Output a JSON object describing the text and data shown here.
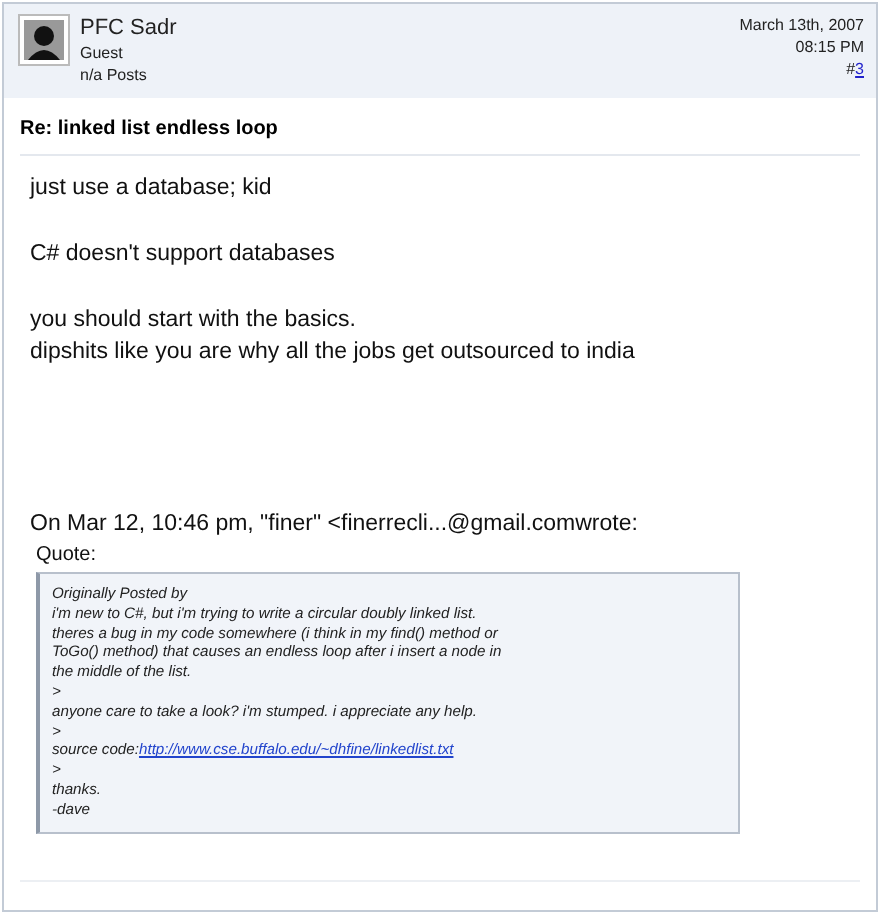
{
  "post": {
    "author": "PFC Sadr",
    "role": "Guest",
    "posts": "n/a Posts",
    "date": "March 13th, 2007",
    "time": "08:15 PM",
    "number_prefix": "#",
    "number": "3"
  },
  "title": "Re: linked list endless loop",
  "body": [
    [
      "just use a database; kid"
    ],
    [
      "C# doesn't support databases"
    ],
    [
      "you should start with the basics.",
      "dipshits like you are why all the jobs get outsourced to india"
    ],
    [
      "On Mar 12, 10:46 pm, \"finer\" <finerrecli...@gmail.comwrote:"
    ]
  ],
  "quote": {
    "label": "Quote:",
    "lines": [
      {
        "kind": "text",
        "text": "Originally Posted by"
      },
      {
        "kind": "text",
        "text": "i'm new to C#, but i'm trying to write a circular doubly linked list."
      },
      {
        "kind": "text",
        "text": "theres a bug in my code somewhere (i think in my find() method or"
      },
      {
        "kind": "text",
        "text": "ToGo() method) that causes an endless loop after i insert a node in"
      },
      {
        "kind": "text",
        "text": "the middle of the list."
      },
      {
        "kind": "text",
        "text": ">"
      },
      {
        "kind": "text",
        "text": "anyone care to take a look? i'm stumped. i appreciate any help."
      },
      {
        "kind": "text",
        "text": ">"
      },
      {
        "kind": "link",
        "text": "source code:",
        "link": "http://www.cse.buffalo.edu/~dhfine/linkedlist.txt"
      },
      {
        "kind": "text",
        "text": ">"
      },
      {
        "kind": "text",
        "text": "thanks."
      },
      {
        "kind": "text",
        "text": "-dave"
      }
    ]
  }
}
